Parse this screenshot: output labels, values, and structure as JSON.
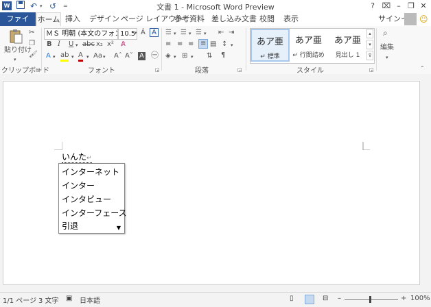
{
  "title": "文書 1 - Microsoft Word Preview",
  "quick_access": {
    "undo": "↶",
    "redo": "↺"
  },
  "window": {
    "help": "?",
    "ribbon_display": "⌧",
    "minimize": "–",
    "restore": "❐",
    "close": "✕"
  },
  "tabs": {
    "file": "ファイル",
    "home": "ホーム",
    "insert": "挿入",
    "design": "デザイン",
    "layout": "ページ レイアウト",
    "references": "参考資料",
    "mailings": "差し込み文書",
    "review": "校閲",
    "view": "表示"
  },
  "account": {
    "signin": "サインイン"
  },
  "clipboard": {
    "paste": "貼り付け",
    "group": "クリップボード"
  },
  "font": {
    "name": "ＭＳ 明朝 (本文のフォント",
    "size": "10.5",
    "group": "フォント",
    "aa": "Aa"
  },
  "paragraph": {
    "group": "段落"
  },
  "styles": {
    "group": "スタイル",
    "items": [
      {
        "preview": "あア亜",
        "name": "↵ 標準"
      },
      {
        "preview": "あア亜",
        "name": "↵ 行間詰め"
      },
      {
        "preview": "あア亜",
        "name": "見出し 1"
      }
    ]
  },
  "editing": {
    "label": "編集"
  },
  "document": {
    "text": "いんた"
  },
  "ime_candidates": [
    "インターネット",
    "インター",
    "インタビュー",
    "インターフェース",
    "引退"
  ],
  "status": {
    "page": "1/1 ページ",
    "words": "3 文字",
    "language": "日本語",
    "zoom": "100%"
  },
  "colors": {
    "accent": "#2b579a",
    "highlight": "#ffff00",
    "font_color": "#c00000"
  }
}
